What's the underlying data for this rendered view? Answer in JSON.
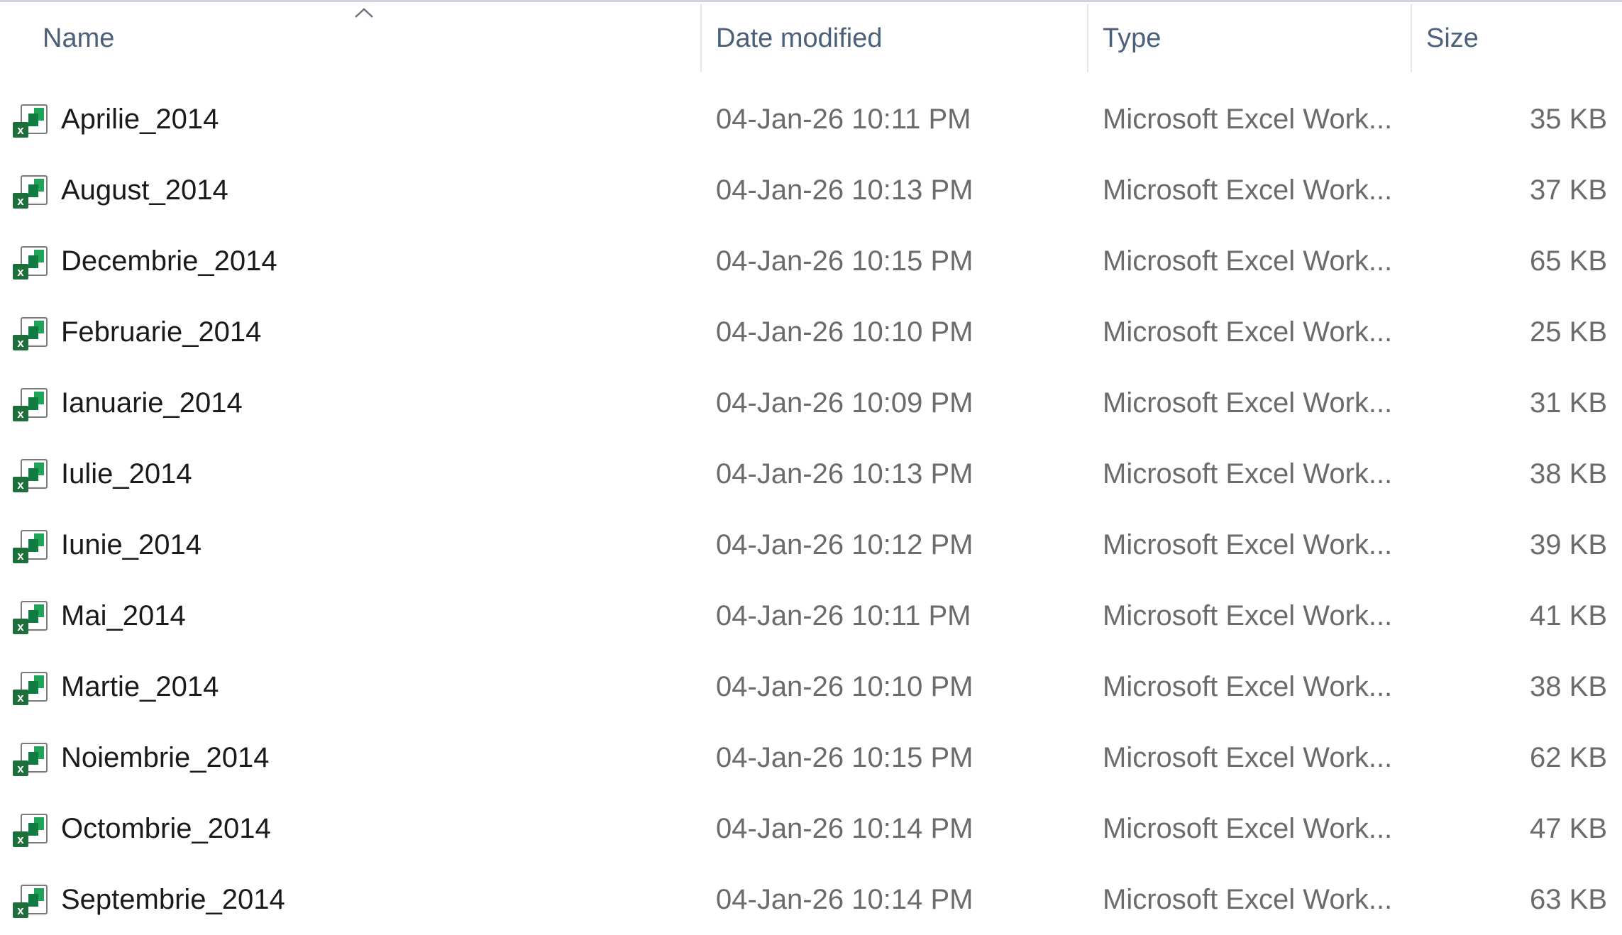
{
  "columns": {
    "name": "Name",
    "date_modified": "Date modified",
    "type": "Type",
    "size": "Size"
  },
  "sort": {
    "column": "Name",
    "direction": "ascending",
    "indicator_icon": "chevron-up-icon"
  },
  "colors": {
    "header_text": "#4c607a",
    "name_text": "#1a1a1a",
    "meta_text": "#6b6b6b",
    "excel_green": "#1d7a3a"
  },
  "files": [
    {
      "name": "Aprilie_2014",
      "date_modified": "04-Jan-26 10:11 PM",
      "type": "Microsoft Excel Work...",
      "size": "35 KB",
      "icon": "excel-file-icon"
    },
    {
      "name": "August_2014",
      "date_modified": "04-Jan-26 10:13 PM",
      "type": "Microsoft Excel Work...",
      "size": "37 KB",
      "icon": "excel-file-icon"
    },
    {
      "name": "Decembrie_2014",
      "date_modified": "04-Jan-26 10:15 PM",
      "type": "Microsoft Excel Work...",
      "size": "65 KB",
      "icon": "excel-file-icon"
    },
    {
      "name": "Februarie_2014",
      "date_modified": "04-Jan-26 10:10 PM",
      "type": "Microsoft Excel Work...",
      "size": "25 KB",
      "icon": "excel-file-icon"
    },
    {
      "name": "Ianuarie_2014",
      "date_modified": "04-Jan-26 10:09 PM",
      "type": "Microsoft Excel Work...",
      "size": "31 KB",
      "icon": "excel-file-icon"
    },
    {
      "name": "Iulie_2014",
      "date_modified": "04-Jan-26 10:13 PM",
      "type": "Microsoft Excel Work...",
      "size": "38 KB",
      "icon": "excel-file-icon"
    },
    {
      "name": "Iunie_2014",
      "date_modified": "04-Jan-26 10:12 PM",
      "type": "Microsoft Excel Work...",
      "size": "39 KB",
      "icon": "excel-file-icon"
    },
    {
      "name": "Mai_2014",
      "date_modified": "04-Jan-26 10:11 PM",
      "type": "Microsoft Excel Work...",
      "size": "41 KB",
      "icon": "excel-file-icon"
    },
    {
      "name": "Martie_2014",
      "date_modified": "04-Jan-26 10:10 PM",
      "type": "Microsoft Excel Work...",
      "size": "38 KB",
      "icon": "excel-file-icon"
    },
    {
      "name": "Noiembrie_2014",
      "date_modified": "04-Jan-26 10:15 PM",
      "type": "Microsoft Excel Work...",
      "size": "62 KB",
      "icon": "excel-file-icon"
    },
    {
      "name": "Octombrie_2014",
      "date_modified": "04-Jan-26 10:14 PM",
      "type": "Microsoft Excel Work...",
      "size": "47 KB",
      "icon": "excel-file-icon"
    },
    {
      "name": "Septembrie_2014",
      "date_modified": "04-Jan-26 10:14 PM",
      "type": "Microsoft Excel Work...",
      "size": "63 KB",
      "icon": "excel-file-icon"
    }
  ]
}
